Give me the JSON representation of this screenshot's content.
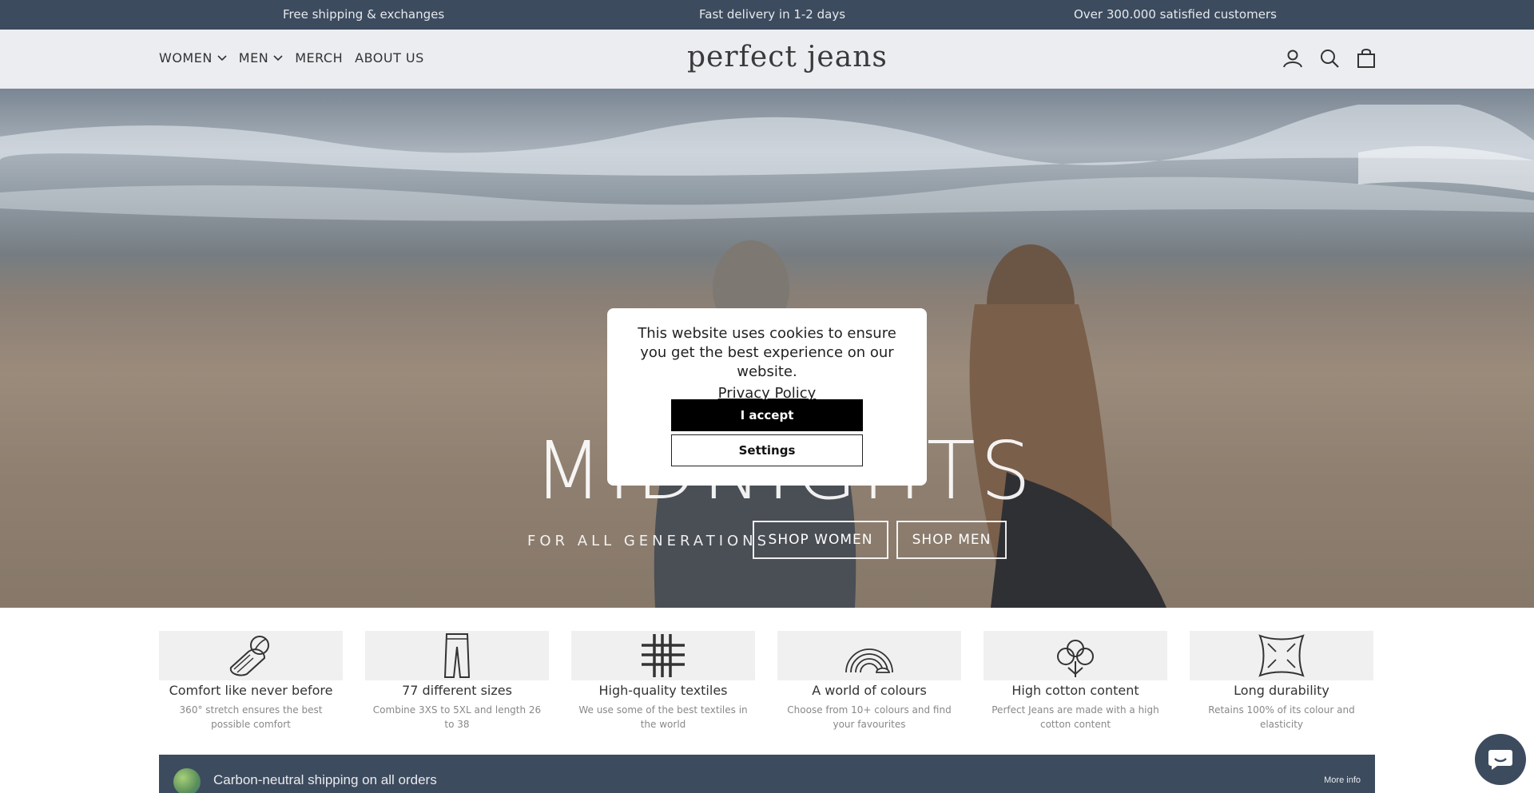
{
  "announcement": {
    "item1": "Free shipping & exchanges",
    "item2": "Fast delivery in 1-2 days",
    "item3": "Over 300.000 satisfied customers"
  },
  "nav": {
    "women": "WOMEN",
    "men": "MEN",
    "merch": "MERCH",
    "about": "ABOUT US"
  },
  "logo": "perfect jeans",
  "header_icons": [
    "account-icon",
    "search-icon",
    "cart-icon"
  ],
  "hero": {
    "title": "MIDNIGHTS",
    "subtitle": "FOR ALL GENERATIONS",
    "shop_women": "SHOP WOMEN",
    "shop_men": "SHOP MEN"
  },
  "cookie": {
    "message": "This website uses cookies to ensure you get the best experience on our website.",
    "privacy_link": "Privacy Policy",
    "accept": "I accept",
    "settings": "Settings"
  },
  "features": [
    {
      "icon": "fabric-roll-icon",
      "title": "Comfort like never before",
      "desc": "360° stretch ensures the best possible comfort"
    },
    {
      "icon": "jeans-icon",
      "title": "77 different sizes",
      "desc": "Combine 3XS to 5XL and length 26 to 38"
    },
    {
      "icon": "weave-icon",
      "title": "High-quality textiles",
      "desc": "We use some of the best textiles in the world"
    },
    {
      "icon": "rainbow-icon",
      "title": "A world of colours",
      "desc": "Choose from 10+ colours and find your favourites"
    },
    {
      "icon": "cotton-icon",
      "title": "High cotton content",
      "desc": "Perfect Jeans are made with a high cotton content"
    },
    {
      "icon": "stretch-frame-icon",
      "title": "Long durability",
      "desc": "Retains 100% of its colour and elasticity"
    }
  ],
  "carbon": {
    "text": "Carbon-neutral shipping on all orders",
    "more_info": "More info"
  },
  "colors": {
    "announcement_bg": "#3d4b5e",
    "header_bg": "#ebedf0",
    "accept_bg": "#000000"
  }
}
